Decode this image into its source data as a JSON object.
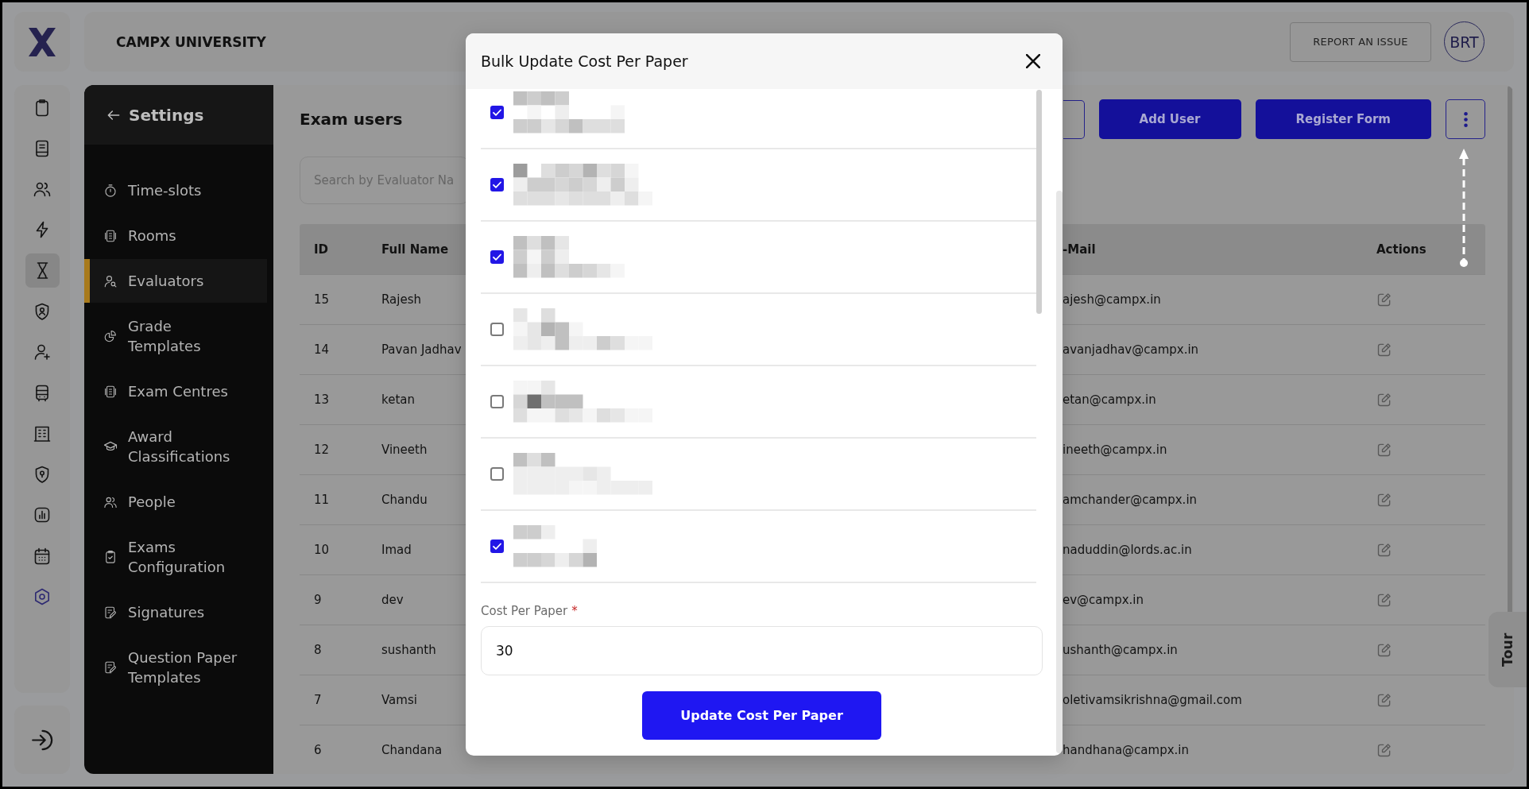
{
  "header": {
    "title": "CAMPX UNIVERSITY",
    "report_button": "REPORT AN ISSUE",
    "avatar": "BRT"
  },
  "rail": {
    "items": [
      {
        "selected": false,
        "accent": false
      },
      {
        "selected": false,
        "accent": false
      },
      {
        "selected": false,
        "accent": false
      },
      {
        "selected": false,
        "accent": false
      },
      {
        "selected": true,
        "accent": false
      },
      {
        "selected": false,
        "accent": false
      },
      {
        "selected": false,
        "accent": false
      },
      {
        "selected": false,
        "accent": false
      },
      {
        "selected": false,
        "accent": false
      },
      {
        "selected": false,
        "accent": false
      },
      {
        "selected": false,
        "accent": false
      },
      {
        "selected": false,
        "accent": false
      },
      {
        "selected": false,
        "accent": true
      }
    ]
  },
  "settings": {
    "title": "Settings",
    "items": [
      {
        "label": "Time-slots",
        "selected": false
      },
      {
        "label": "Rooms",
        "selected": false
      },
      {
        "label": "Evaluators",
        "selected": true
      },
      {
        "label": "Grade Templates",
        "selected": false
      },
      {
        "label": "Exam Centres",
        "selected": false
      },
      {
        "label": "Award Classifications",
        "selected": false
      },
      {
        "label": "People",
        "selected": false
      },
      {
        "label": "Exams Configuration",
        "selected": false
      },
      {
        "label": "Signatures",
        "selected": false
      },
      {
        "label": "Question Paper Templates",
        "selected": false
      }
    ]
  },
  "page": {
    "title": "Exam users",
    "buttons": [
      {
        "kind": "outline"
      },
      {
        "kind": "primary",
        "label": "Add User"
      },
      {
        "kind": "primary",
        "label": "Register Form"
      },
      {
        "kind": "menu"
      }
    ],
    "search": {
      "placeholder": "Search by Evaluator Na"
    },
    "table": {
      "columns": [
        "ID",
        "Full Name",
        "-Mail",
        "Actions"
      ],
      "rows": [
        [
          "15",
          "Rajesh",
          "ajesh@campx.in"
        ],
        [
          "14",
          "Pavan Jadhav",
          "avanjadhav@campx.in"
        ],
        [
          "13",
          "ketan",
          "etan@campx.in"
        ],
        [
          "12",
          "Vineeth",
          "ineeth@campx.in"
        ],
        [
          "11",
          "Chandu",
          "amchander@campx.in"
        ],
        [
          "10",
          "Imad",
          "naduddin@lords.ac.in"
        ],
        [
          "9",
          "dev",
          "ev@campx.in"
        ],
        [
          "8",
          "sushanth",
          "ushanth@campx.in"
        ],
        [
          "7",
          "Vamsi",
          "oletivamsikrishna@gmail.com"
        ],
        [
          "6",
          "Chandana",
          "handhana@campx.in"
        ]
      ]
    }
  },
  "tour": {
    "label": "Tour"
  },
  "modal": {
    "title": "Bulk Update Cost Per Paper",
    "items": [
      {
        "checked": true
      },
      {
        "checked": true
      },
      {
        "checked": true
      },
      {
        "checked": false
      },
      {
        "checked": false
      },
      {
        "checked": false
      },
      {
        "checked": true
      }
    ],
    "cost_field": {
      "label": "Cost Per Paper",
      "required_mark": "*",
      "value": "30"
    },
    "submit_button": "Update Cost Per Paper"
  }
}
